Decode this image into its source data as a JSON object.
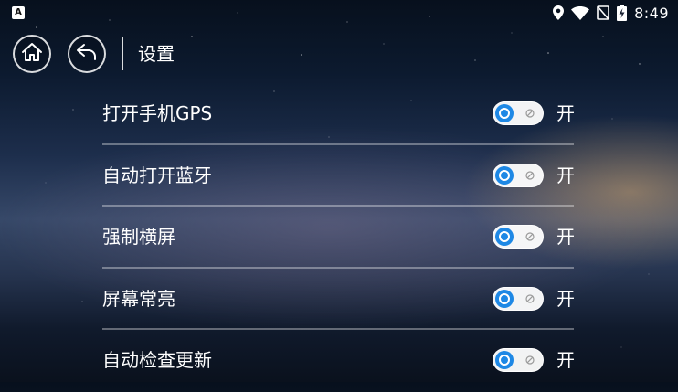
{
  "status_bar": {
    "app_icon_letter": "A",
    "time": "8:49",
    "icons": [
      "location-icon",
      "wifi-icon",
      "no-sim-icon",
      "battery-charging-icon"
    ]
  },
  "header": {
    "title": "设置",
    "home_icon": "home-icon",
    "back_icon": "back-arrow-icon"
  },
  "settings": [
    {
      "label": "打开手机GPS",
      "state": "开",
      "enabled": true
    },
    {
      "label": "自动打开蓝牙",
      "state": "开",
      "enabled": true
    },
    {
      "label": "强制横屏",
      "state": "开",
      "enabled": true
    },
    {
      "label": "屏幕常亮",
      "state": "开",
      "enabled": true
    },
    {
      "label": "自动检查更新",
      "state": "开",
      "enabled": true
    }
  ],
  "colors": {
    "switch_knob": "#1e88e5",
    "switch_track": "#ffffff"
  }
}
